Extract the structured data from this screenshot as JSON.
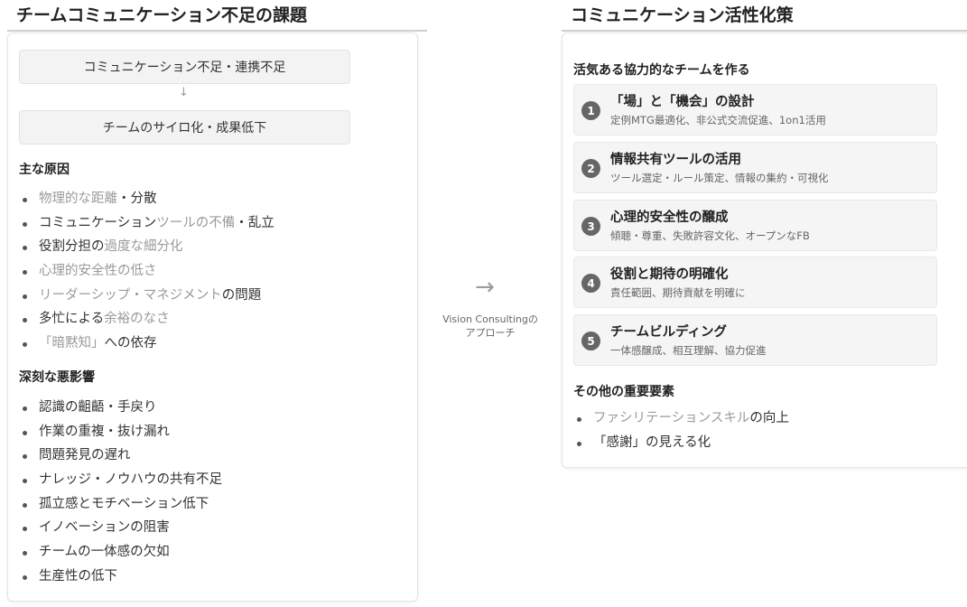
{
  "left": {
    "title": "チームコミュニケーション不足の課題",
    "flow": {
      "box1": "コミュニケーション不足・連携不足",
      "arrow": "↓",
      "box2": "チームのサイロ化・成果低下"
    },
    "causes_heading": "主な原因",
    "causes": [
      {
        "a": "物理的な距離",
        "b": "・分散",
        "c": ""
      },
      {
        "a": "コミュニケーション",
        "b": "ツールの不備",
        "c": "・乱立"
      },
      {
        "a": "役割分担の",
        "b": "過度な細分化",
        "c": ""
      },
      {
        "a": "心理的安全性の低さ",
        "b": "",
        "c": ""
      },
      {
        "a": "リーダーシップ・マネジメント",
        "b": "の問題",
        "c": ""
      },
      {
        "a": "多忙による",
        "b": "余裕のなさ",
        "c": ""
      },
      {
        "a": "「暗黙知」",
        "b": "への依存",
        "c": ""
      }
    ],
    "effects_heading": "深刻な悪影響",
    "effects": [
      "認識の齟齬・手戻り",
      "作業の重複・抜け漏れ",
      "問題発見の遅れ",
      "ナレッジ・ノウハウの共有不足",
      "孤立感とモチベーション低下",
      "イノベーションの阻害",
      "チームの一体感の欠如",
      "生産性の低下"
    ]
  },
  "center": {
    "arrow": "→",
    "label_line1": "Vision Consultingの",
    "label_line2": "アプローチ"
  },
  "right": {
    "title": "コミュニケーション活性化策",
    "goal_heading": "活気ある協力的なチームを作る",
    "steps": [
      {
        "num": "1",
        "title": "「場」と「機会」の設計",
        "desc": "定例MTG最適化、非公式交流促進、1on1活用"
      },
      {
        "num": "2",
        "title": "情報共有ツールの活用",
        "desc": "ツール選定・ルール策定、情報の集約・可視化"
      },
      {
        "num": "3",
        "title": "心理的安全性の醸成",
        "desc": "傾聴・尊重、失敗許容文化、オープンなFB"
      },
      {
        "num": "4",
        "title": "役割と期待の明確化",
        "desc": "責任範囲、期待貢献を明確に"
      },
      {
        "num": "5",
        "title": "チームビルディング",
        "desc": "一体感醸成、相互理解、協力促進"
      }
    ],
    "other_heading": "その他の重要要素",
    "others": [
      {
        "a": "ファシリテーションスキル",
        "b": "の向上"
      },
      {
        "a": "「感謝」の見える化",
        "b": ""
      }
    ]
  },
  "colors": {
    "muted_text": "#9a9a9a",
    "step_badge": "#666666",
    "box_bg": "#f3f3f3"
  }
}
